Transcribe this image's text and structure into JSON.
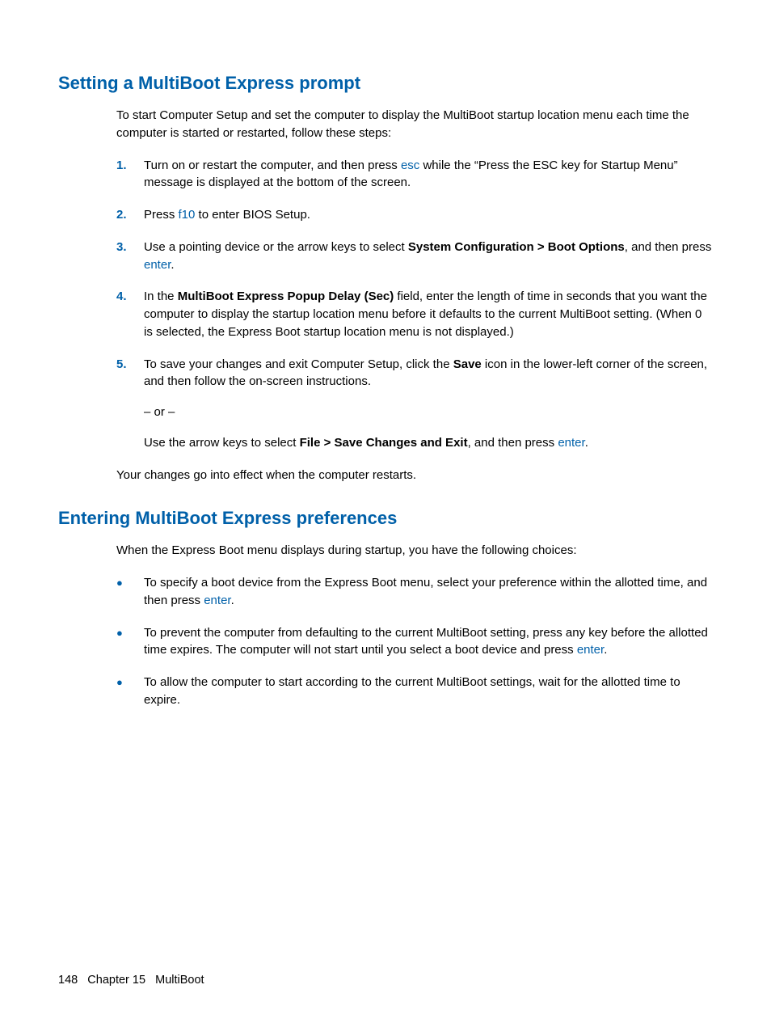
{
  "section1": {
    "heading": "Setting a MultiBoot Express prompt",
    "intro": "To start Computer Setup and set the computer to display the MultiBoot startup location menu each time the computer is started or restarted, follow these steps:",
    "steps": {
      "s1": {
        "num": "1.",
        "t1": "Turn on or restart the computer, and then press ",
        "kw": "esc",
        "t2": " while the “Press the ESC key for Startup Menu” message is displayed at the bottom of the screen."
      },
      "s2": {
        "num": "2.",
        "t1": "Press ",
        "kw": "f10",
        "t2": " to enter BIOS Setup."
      },
      "s3": {
        "num": "3.",
        "t1": "Use a pointing device or the arrow keys to select ",
        "b1": "System Configuration > Boot Options",
        "t2": ", and then press ",
        "kw": "enter",
        "t3": "."
      },
      "s4": {
        "num": "4.",
        "t1": "In the ",
        "b1": "MultiBoot Express Popup Delay (Sec)",
        "t2": " field, enter the length of time in seconds that you want the computer to display the startup location menu before it defaults to the current MultiBoot setting. (When 0 is selected, the Express Boot startup location menu is not displayed.)"
      },
      "s5": {
        "num": "5.",
        "t1": "To save your changes and exit Computer Setup, click the ",
        "b1": "Save",
        "t2": " icon in the lower-left corner of the screen, and then follow the on-screen instructions.",
        "or": "– or –",
        "t3": "Use the arrow keys to select ",
        "b2": "File > Save Changes and Exit",
        "t4": ", and then press ",
        "kw": "enter",
        "t5": "."
      }
    },
    "outro": "Your changes go into effect when the computer restarts."
  },
  "section2": {
    "heading": "Entering MultiBoot Express preferences",
    "intro": "When the Express Boot menu displays during startup, you have the following choices:",
    "bullets": {
      "b1": {
        "t1": "To specify a boot device from the Express Boot menu, select your preference within the allotted time, and then press ",
        "kw": "enter",
        "t2": "."
      },
      "b2": {
        "t1": "To prevent the computer from defaulting to the current MultiBoot setting, press any key before the allotted time expires. The computer will not start until you select a boot device and press ",
        "kw": "enter",
        "t2": "."
      },
      "b3": {
        "t1": "To allow the computer to start according to the current MultiBoot settings, wait for the allotted time to expire."
      }
    }
  },
  "footer": {
    "page": "148",
    "chapter": "Chapter 15",
    "title": "MultiBoot"
  },
  "glyphs": {
    "bullet": "●"
  }
}
